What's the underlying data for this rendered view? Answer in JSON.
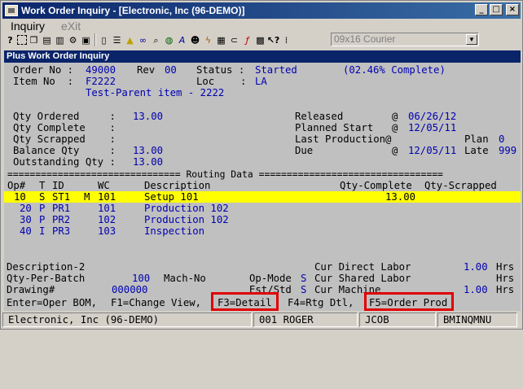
{
  "window": {
    "title": "Work Order Inquiry - [Electronic, Inc (96-DEMO)]",
    "btn_min": "_",
    "btn_max": "□",
    "btn_close": "×"
  },
  "menu": {
    "inquiry": "Inquiry",
    "exit": "eXit"
  },
  "toolbar": {
    "font": "09x16 Courier",
    "font_dropdown": "▼"
  },
  "subtitle": "Plus Work Order Inquiry",
  "header": {
    "order_no_label": "Order No :",
    "order_no": "49000",
    "rev_label": "Rev",
    "rev": "00",
    "status_label": "Status :",
    "status": "Started",
    "percent": "(02.46% Complete)",
    "item_no_label": "Item No  :",
    "item_no": "F2222",
    "loc_label": "Loc",
    "loc_colon": ":",
    "loc": "LA",
    "item_desc": "Test-Parent item - 2222"
  },
  "qty": {
    "ordered_label": "Qty Ordered     :",
    "ordered": "13.00",
    "complete_label": "Qty Complete    :",
    "scrapped_label": "Qty Scrapped    :",
    "balance_label": "Balance Qty     :",
    "balance": "13.00",
    "outstanding_label": "Outstanding Qty :",
    "outstanding": "13.00"
  },
  "dates": {
    "released_label": "Released",
    "released_at": "@",
    "released": "06/26/12",
    "planned_label": "Planned Start",
    "planned_at": "@",
    "planned": "12/05/11",
    "last_prod_label": "Last Production@",
    "plan_label": "Plan",
    "plan": "0",
    "due_label": "Due",
    "due_at": "@",
    "due": "12/05/11",
    "late_label": "Late",
    "late": "999"
  },
  "routing": {
    "separator": "=============================== Routing Data =================================",
    "headers": {
      "op": "Op#",
      "t": "T",
      "id": "ID",
      "wc": "WC",
      "desc": "Description",
      "qty_complete": "Qty-Complete",
      "qty_scrapped": "Qty-Scrapped"
    },
    "rows": [
      {
        "op": "10",
        "t": "S",
        "id": "ST1",
        "m": "M",
        "wc": "101",
        "desc": "Setup 101",
        "qty_complete": "13.00",
        "qty_scrapped": ""
      },
      {
        "op": "20",
        "t": "P",
        "id": "PR1",
        "m": "",
        "wc": "101",
        "desc": "Production 102",
        "qty_complete": "",
        "qty_scrapped": ""
      },
      {
        "op": "30",
        "t": "P",
        "id": "PR2",
        "m": "",
        "wc": "102",
        "desc": "Production 102",
        "qty_complete": "",
        "qty_scrapped": ""
      },
      {
        "op": "40",
        "t": "I",
        "id": "PR3",
        "m": "",
        "wc": "103",
        "desc": "Inspection",
        "qty_complete": "",
        "qty_scrapped": ""
      }
    ]
  },
  "detail": {
    "desc2_label": "Description-2",
    "qty_per_batch_label": "Qty-Per-Batch",
    "qty_per_batch": "100",
    "mach_no_label": "Mach-No",
    "drawing_label": "Drawing#",
    "drawing": "000000",
    "op_mode_label": "Op-Mode",
    "op_mode": "S",
    "est_std_label": "Est/Std",
    "est_std": "S",
    "cur_direct_labor_label": "Cur Direct Labor",
    "cur_direct_labor": "1.00",
    "cur_shared_labor_label": "Cur Shared Labor",
    "cur_machine_label": "Cur Machine",
    "cur_machine": "1.00",
    "hrs": "Hrs"
  },
  "keys": {
    "enter": "Enter=Oper BOM,",
    "f1": "F1=Change View,",
    "f3": "F3=Detail",
    "f4": "F4=Rtg Dtl,",
    "f5": "F5=Order Prod"
  },
  "statusbar": {
    "company": "Electronic, Inc (96-DEMO)",
    "user": "001 ROGER",
    "login": "JCOB",
    "program": "BMINQMNU"
  },
  "colors": {
    "highlight": "#ffff00",
    "value_blue": "#0000b0",
    "redbox": "#e00000",
    "title_blue": "#0a246a"
  }
}
